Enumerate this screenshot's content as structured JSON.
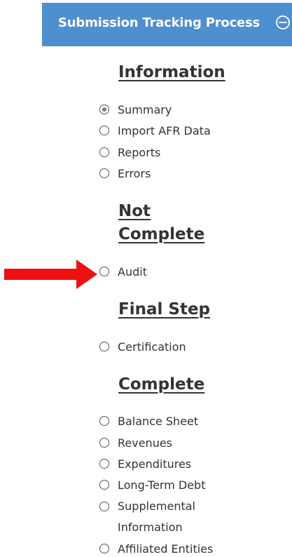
{
  "header": {
    "title": "Submission Tracking Process",
    "icon": "minus-circle-icon",
    "bg_color": "#4e8fcf"
  },
  "sections": {
    "information": {
      "heading": "Information",
      "items": [
        {
          "label": "Summary",
          "checked": true
        },
        {
          "label": "Import AFR Data",
          "checked": false
        },
        {
          "label": "Reports",
          "checked": false
        },
        {
          "label": "Errors",
          "checked": false
        }
      ]
    },
    "not_complete": {
      "heading_line1": "Not",
      "heading_line2": "Complete",
      "items": [
        {
          "label": "Audit",
          "checked": false
        }
      ]
    },
    "final_step": {
      "heading": "Final Step",
      "items": [
        {
          "label": "Certification",
          "checked": false
        }
      ]
    },
    "complete": {
      "heading": "Complete",
      "items": [
        {
          "label": "Balance Sheet",
          "checked": false
        },
        {
          "label": "Revenues",
          "checked": false
        },
        {
          "label": "Expenditures",
          "checked": false
        },
        {
          "label": "Long-Term Debt",
          "checked": false
        },
        {
          "label": "Supplemental Information",
          "checked": false
        },
        {
          "label": "Affiliated Entities",
          "checked": false
        }
      ]
    }
  },
  "annotation": {
    "arrow_icon": "red-arrow-right-icon",
    "arrow_color": "#ee1111"
  }
}
